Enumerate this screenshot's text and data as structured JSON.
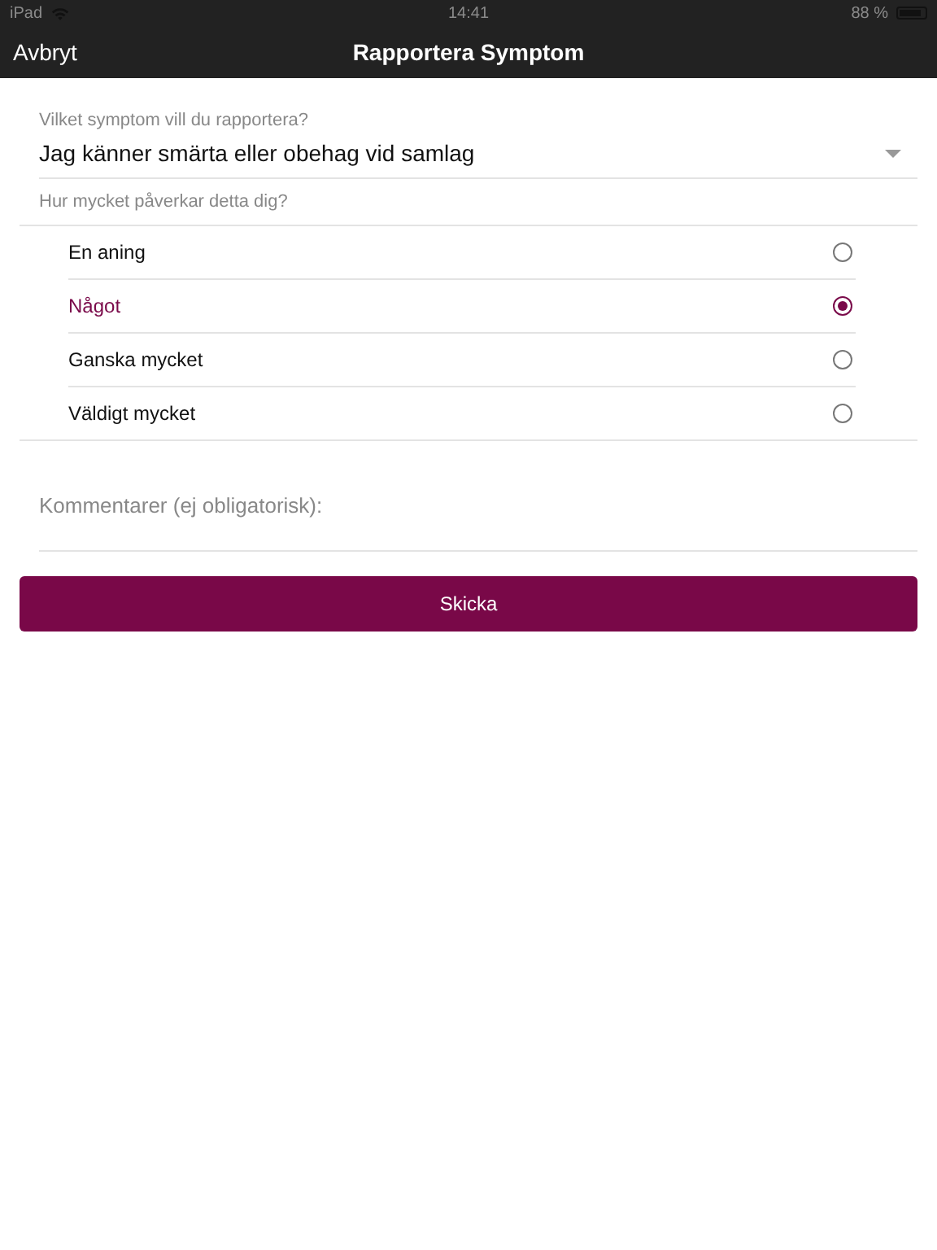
{
  "status_bar": {
    "device": "iPad",
    "time": "14:41",
    "battery": "88 %"
  },
  "nav_bar": {
    "cancel": "Avbryt",
    "title": "Rapportera Symptom"
  },
  "symptom": {
    "label": "Vilket symptom vill du rapportera?",
    "value": "Jag känner smärta eller obehag vid samlag"
  },
  "severity": {
    "label": "Hur mycket påverkar detta dig?",
    "options": [
      {
        "label": "En aning",
        "selected": false
      },
      {
        "label": "Något",
        "selected": true
      },
      {
        "label": "Ganska mycket",
        "selected": false
      },
      {
        "label": "Väldigt mycket",
        "selected": false
      }
    ]
  },
  "comment": {
    "placeholder": "Kommentarer (ej obligatorisk):"
  },
  "submit": "Skicka"
}
